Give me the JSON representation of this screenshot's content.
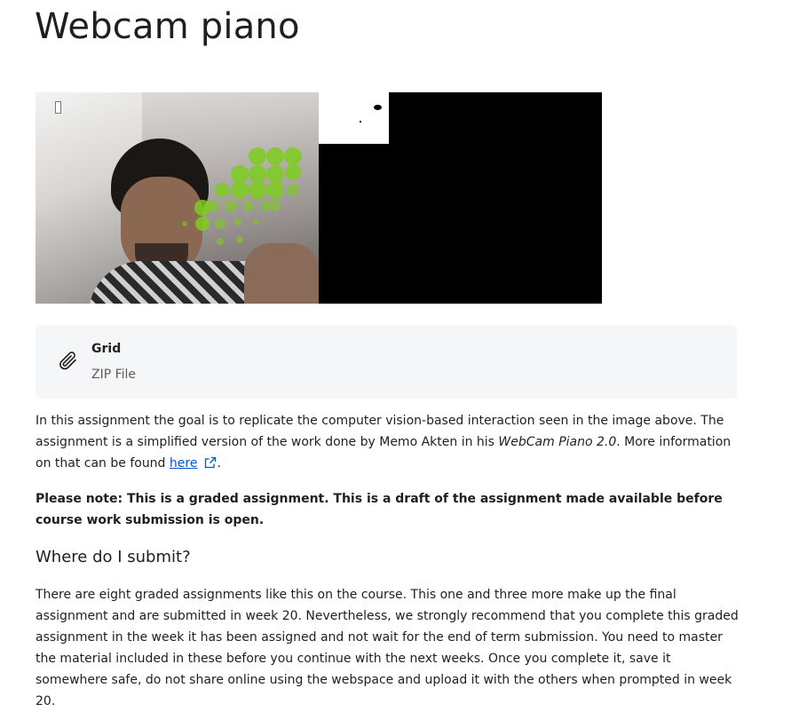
{
  "page": {
    "title": "Webcam piano"
  },
  "image": {
    "grid_dot_color": "#7dcc1e",
    "mask_color": "#000000"
  },
  "file_card": {
    "icon": "paperclip-icon",
    "name": "Grid",
    "type": "ZIP File"
  },
  "content": {
    "p1_part1": "In this assignment the goal is to replicate the computer vision-based interaction seen in the image above. The assignment is a simplified version of the work done by Memo Akten in his ",
    "p1_em": "WebCam Piano 2.0",
    "p1_part2": ". More information on that can be found ",
    "p1_link": "here",
    "p1_link_icon": "external-link-icon",
    "p1_end": ".",
    "note": "Please note: This is a graded assignment. This is a draft of the assignment made available before course work submission is open.",
    "heading": "Where do I submit?",
    "p3": "There are eight graded assignments like this on the course. This one and three more make up the final assignment and are submitted in week 20. Nevertheless, we strongly recommend that you complete this graded assignment in the week it has been assigned and not wait for the end of term submission. You need to master the material included in these before you continue with the next weeks. Once you complete it, save it somewhere safe, do not share online using the webspace and upload it with the others when prompted in week 20."
  }
}
